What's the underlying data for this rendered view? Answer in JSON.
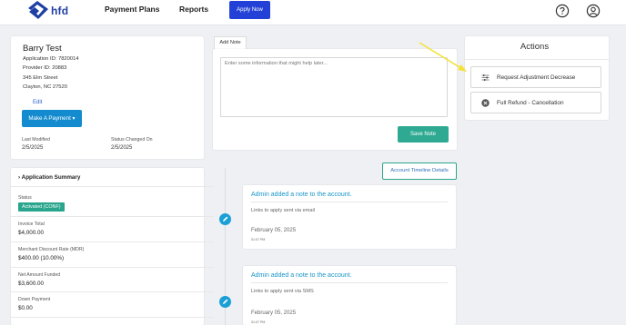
{
  "nav": {
    "logo_text": "hfd",
    "links": [
      "Payment Plans",
      "Reports"
    ],
    "apply_now": "Apply Now",
    "help_icon": "help-circle-icon",
    "account_icon": "user-circle-icon"
  },
  "profile": {
    "name": "Barry Test",
    "application_id": "Application ID: 7820014",
    "provider_id": "Provider ID: 20883",
    "street": "345 Elm Street",
    "city": "Clayton, NC 27520",
    "edit": "Edit",
    "make_payment": "Make A Payment",
    "last_modified_label": "Last Modified",
    "last_modified_value": "2/5/2025",
    "status_changed_label": "Status Changed On",
    "status_changed_value": "2/5/2025"
  },
  "summary": {
    "title": "Application Summary",
    "status_label": "Status",
    "status_value": "Activated (CONF)",
    "invoice_label": "Invoice Total",
    "invoice_value": "$4,000.00",
    "mdr_label": "Merchant Discount Rate (MDR)",
    "mdr_value": "$400.00 (10.00%)",
    "net_label": "Net Amount Funded",
    "net_value": "$3,600.00",
    "down_label": "Down Payment",
    "down_value": "$0.00"
  },
  "note": {
    "tab_label": "Add Note",
    "placeholder": "Enter some information that might help later...",
    "save": "Save Note"
  },
  "actions": {
    "title": "Actions",
    "items": [
      {
        "label": "Request Adjustment Decrease",
        "icon": "sliders-icon"
      },
      {
        "label": "Full Refund - Cancellation",
        "icon": "cancel-circle-icon"
      }
    ]
  },
  "timeline": {
    "details_button": "Account Timeline Details",
    "entries": [
      {
        "title": "Admin added a note to the account.",
        "text": "Links to apply sent via email",
        "date": "February 05, 2025",
        "time": "01:07 PM"
      },
      {
        "title": "Admin added a note to the account.",
        "text": "Links to apply sent via SMS",
        "date": "February 05, 2025",
        "time": "01:07 PM"
      }
    ]
  },
  "colors": {
    "brand": "#1e3fa3",
    "primary_button": "#2341d6",
    "teal": "#2eaa92",
    "link": "#1795c6",
    "annotation_arrow": "#f5e13a"
  }
}
